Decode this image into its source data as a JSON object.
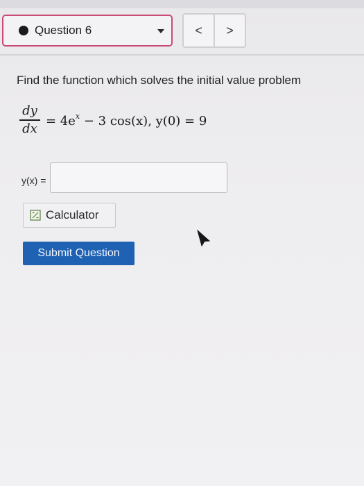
{
  "header": {
    "question_label": "Question 6",
    "prev_symbol": "<",
    "next_symbol": ">"
  },
  "prompt": "Find the function which solves the initial value problem",
  "equation": {
    "numerator": "dy",
    "denominator": "dx",
    "rhs_prefix": "= 4e",
    "exponent": "x",
    "rhs_suffix": " − 3 cos(x),  y(0) = 9"
  },
  "answer": {
    "label": "y(x) =",
    "value": "",
    "placeholder": ""
  },
  "calculator_label": "Calculator",
  "submit_label": "Submit Question",
  "icons": {
    "status": "filled-dot-icon",
    "dropdown": "caret-down-icon",
    "calculator": "calculator-icon",
    "cursor": "mouse-pointer-icon"
  },
  "colors": {
    "select_border": "#c94a73",
    "submit_bg": "#1f62b4",
    "status_dot": "#1a1a1d"
  }
}
